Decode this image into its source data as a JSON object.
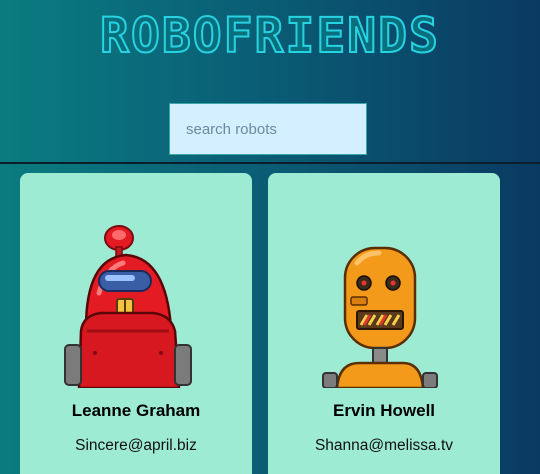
{
  "app": {
    "title": "ROBOFRIENDS"
  },
  "search": {
    "placeholder": "search robots"
  },
  "robots": [
    {
      "name": "Leanne Graham",
      "email": "Sincere@april.biz"
    },
    {
      "name": "Ervin Howell",
      "email": "Shanna@melissa.tv"
    }
  ]
}
